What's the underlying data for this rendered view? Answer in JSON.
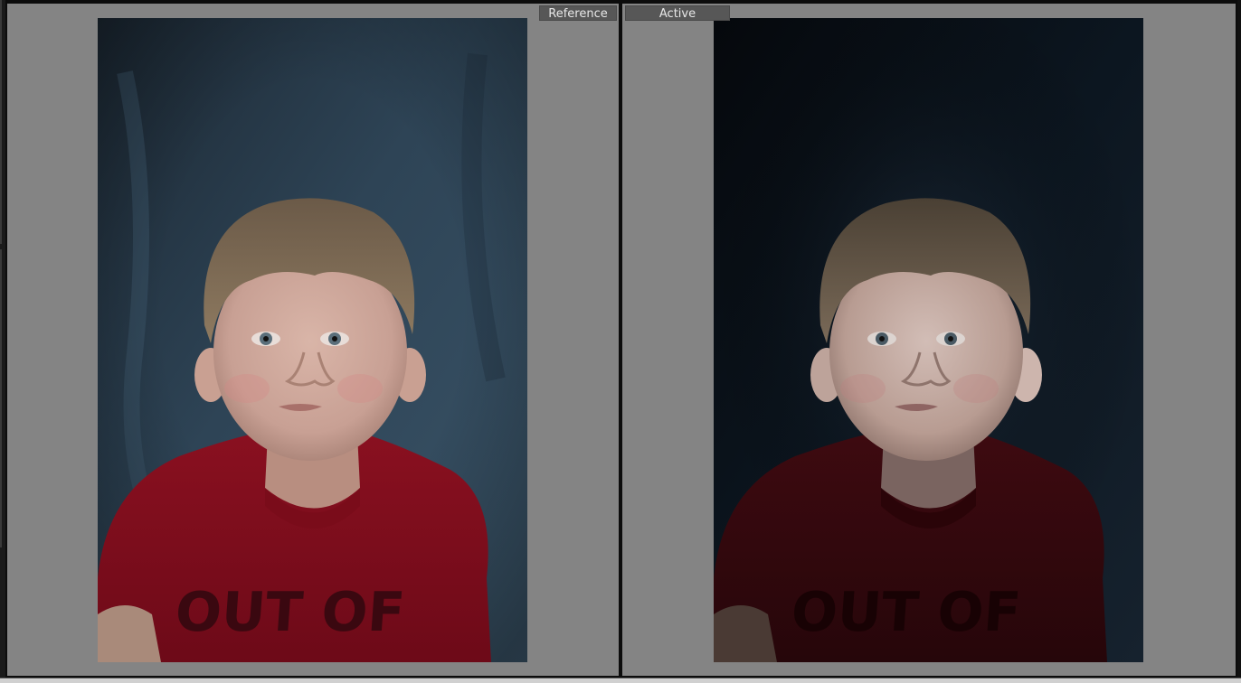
{
  "compare_view": {
    "reference": {
      "label": "Reference",
      "shirt_text": "OUT OF"
    },
    "active": {
      "label": "Active",
      "shirt_text": "OUT OF"
    }
  },
  "colors": {
    "pane_background": "#848484",
    "label_background": "#575757",
    "label_text": "#e8e8e8"
  },
  "icons": {
    "reference_photo": "portrait-photo",
    "active_photo": "portrait-photo-dark"
  }
}
